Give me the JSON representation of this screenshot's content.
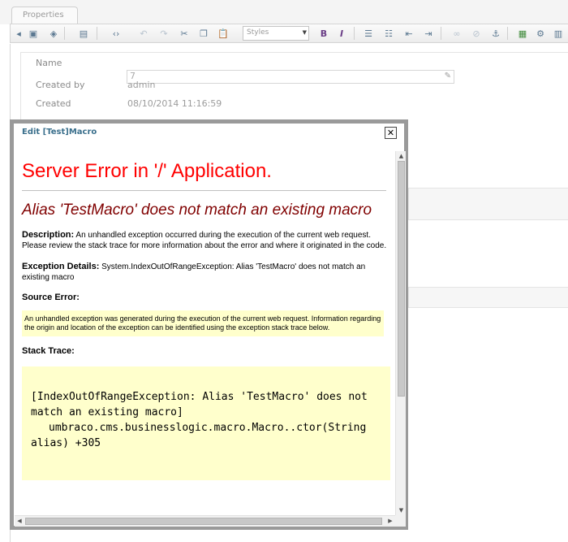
{
  "properties_tab": {
    "label": "Properties"
  },
  "toolbar": {
    "styles_select": {
      "value": "Styles"
    },
    "icons": {
      "back": "arrow-left-icon",
      "save": "save-icon",
      "save_publish": "save-publish-icon",
      "preview": "preview-icon",
      "source": "html-source-icon",
      "undo": "undo-icon",
      "redo": "redo-icon",
      "cut": "cut-icon",
      "copy": "copy-icon",
      "paste": "paste-icon",
      "bold": "bold-icon",
      "italic": "italic-icon",
      "bullet_list": "bullet-list-icon",
      "numbered_list": "numbered-list-icon",
      "outdent": "outdent-icon",
      "indent": "indent-icon",
      "link": "link-icon",
      "unlink": "unlink-icon",
      "anchor": "anchor-icon",
      "image": "image-icon",
      "macro": "macro-icon",
      "table": "table-icon"
    },
    "glyphs": {
      "back": "◂",
      "save": "▣",
      "save_publish": "◈",
      "preview": "▤",
      "source": "‹›",
      "undo": "↶",
      "redo": "↷",
      "cut": "✂",
      "copy": "❐",
      "paste": "📋",
      "bold": "B",
      "italic": "I",
      "bullet_list": "☰",
      "numbered_list": "☷",
      "outdent": "⇤",
      "indent": "⇥",
      "link": "∞",
      "unlink": "⊘",
      "anchor": "⚓",
      "image": "▦",
      "macro": "⚙",
      "table": "▥",
      "dropdown": "▼"
    }
  },
  "properties": {
    "name": {
      "label": "Name",
      "value": "7"
    },
    "created_by": {
      "label": "Created by",
      "value": "admin"
    },
    "created": {
      "label": "Created",
      "value": "08/10/2014 11:16:59"
    }
  },
  "dialog": {
    "title": "Edit [Test]Macro",
    "close_glyph": "✕",
    "error": {
      "heading": "Server Error in '/' Application.",
      "message": "Alias 'TestMacro' does not match an existing macro",
      "description_label": "Description:",
      "description_text": "An unhandled exception occurred during the execution of the current web request. Please review the stack trace for more information about the error and where it originated in the code.",
      "exception_label": "Exception Details:",
      "exception_text": "System.IndexOutOfRangeException: Alias 'TestMacro' does not match an existing macro",
      "source_error_label": "Source Error:",
      "source_error_text": "An unhandled exception was generated during the execution of the current web request. Information regarding the origin and location of the exception can be identified using the exception stack trace below.",
      "stack_trace_label": "Stack Trace:",
      "stack_line_1": "[IndexOutOfRangeException: Alias 'TestMacro' does not",
      "stack_line_2": "match an existing macro]",
      "stack_line_3": "umbraco.cms.businesslogic.macro.Macro..ctor(String",
      "stack_line_4": "alias) +305"
    },
    "scroll_glyphs": {
      "up": "▲",
      "down": "▼",
      "left": "◀",
      "right": "▶"
    }
  }
}
